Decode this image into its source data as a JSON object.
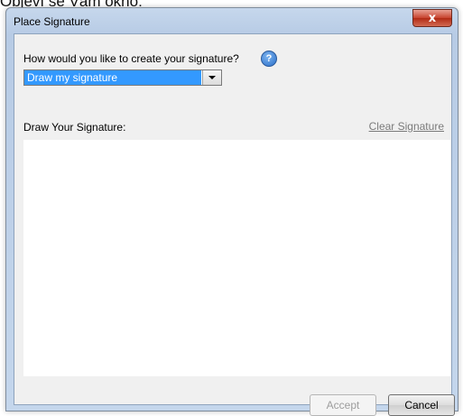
{
  "background": {
    "caption": "Objeví se Vám okno:"
  },
  "dialog": {
    "title": "Place Signature",
    "close_glyph": "x",
    "question": "How would you like to create your signature?",
    "help_glyph": "?",
    "method_select": {
      "value": "Draw my signature"
    },
    "draw_label": "Draw Your Signature:",
    "clear_link": "Clear Signature",
    "accept_label": "Accept",
    "cancel_label": "Cancel"
  },
  "colors": {
    "select_highlight": "#3399ff",
    "close_red": "#c7432e",
    "link_gray": "#7b7b7b"
  },
  "icons": [
    "help-icon",
    "close-icon",
    "chevron-down-icon"
  ]
}
